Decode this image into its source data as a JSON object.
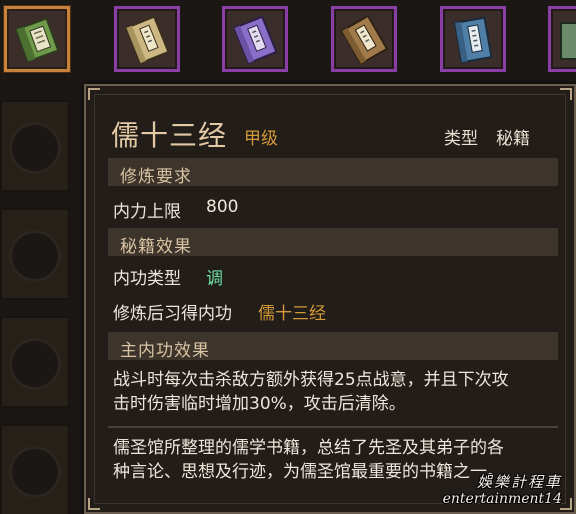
{
  "inventory": {
    "slots": [
      {
        "icon": "green-scroll-book-icon",
        "selected": true,
        "book_color": "#6f9a4a"
      },
      {
        "icon": "tan-manual-book-icon",
        "selected": false,
        "book_color": "#cdb884"
      },
      {
        "icon": "purple-manual-book-icon",
        "selected": false,
        "book_color": "#8a6fc9"
      },
      {
        "icon": "brown-manual-book-icon",
        "selected": false,
        "book_color": "#a07a48"
      },
      {
        "icon": "blue-manual-book-icon",
        "selected": false,
        "book_color": "#4f7ea6"
      },
      {
        "icon": "partial-book-icon",
        "selected": false,
        "book_color": "#6a8a6a"
      }
    ]
  },
  "tooltip": {
    "title": "儒十三经",
    "grade": "甲级",
    "type_label": "类型",
    "type_value": "秘籍",
    "sections": {
      "requirements": "修炼要求",
      "effects": "秘籍效果",
      "main_effect": "主内功效果"
    },
    "requirement_rows": [
      {
        "label": "内力上限",
        "value": "800"
      }
    ],
    "effect_rows": [
      {
        "label": "内功类型",
        "value": "调"
      },
      {
        "label": "修炼后习得内功",
        "value": "儒十三经"
      }
    ],
    "main_effect_lines": [
      "战斗时每次击杀敌方额外获得25点战意，并且下次攻",
      "击时伤害临时增加30%，攻击后清除。"
    ],
    "description_lines": [
      "儒圣馆所整理的儒学书籍，总结了先圣及其弟子的各",
      "种言论、思想及行迹，为儒圣馆最重要的书籍之一。"
    ]
  },
  "watermark": {
    "line1": "娛樂計程車",
    "line2": "entertainment14"
  },
  "colors": {
    "title": "#e2c9a4",
    "grade": "#d49a3a",
    "value_cyan": "#6ee0a8",
    "value_orange": "#d49a3a",
    "slot_border": "#8a3fa6",
    "slot_selected_border": "#c9823a"
  }
}
